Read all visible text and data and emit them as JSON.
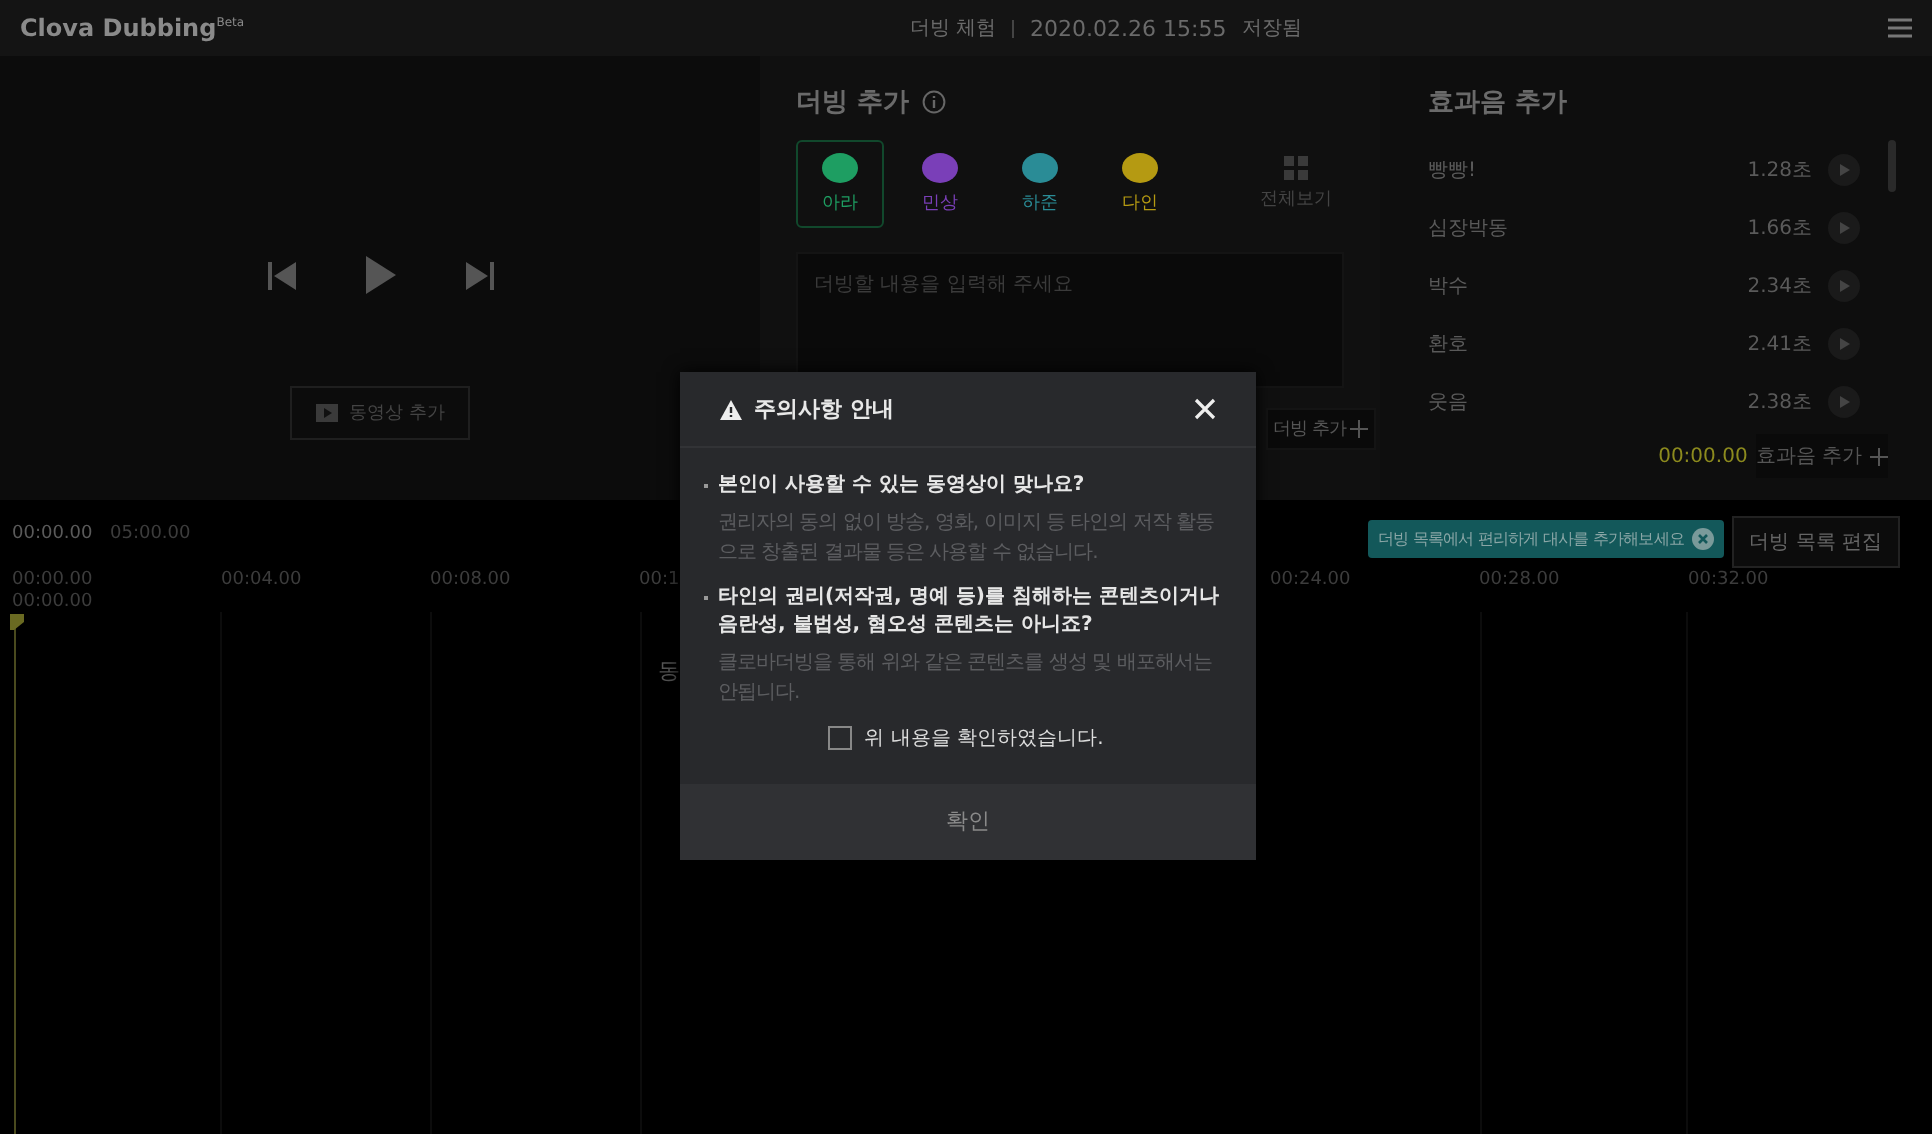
{
  "header": {
    "logo": "Clova Dubbing",
    "logo_badge": "Beta",
    "project": "더빙 체험",
    "saved_time": "2020.02.26 15:55",
    "saved_label": "저장됨"
  },
  "video": {
    "add_button": "동영상 추가"
  },
  "dubbing": {
    "title": "더빙 추가",
    "voices": [
      {
        "name": "아라",
        "color": "#1e9e62",
        "selected": true
      },
      {
        "name": "민상",
        "color": "#7a3fb8",
        "selected": false
      },
      {
        "name": "하준",
        "color": "#2a8c96",
        "selected": false
      },
      {
        "name": "다인",
        "color": "#b59a12",
        "selected": false
      }
    ],
    "all_view": "전체보기",
    "input": {
      "placeholder": "더빙할 내용을 입력해 주세요"
    },
    "add_button": "더빙 추가"
  },
  "effects": {
    "title": "효과음 추가",
    "items": [
      {
        "name": "빵빵!",
        "duration": "1.28초"
      },
      {
        "name": "심장박동",
        "duration": "1.66초"
      },
      {
        "name": "박수",
        "duration": "2.34초"
      },
      {
        "name": "환호",
        "duration": "2.41초"
      },
      {
        "name": "웃음",
        "duration": "2.38초"
      }
    ],
    "time": "00:00.00",
    "add_button": "효과음 추가"
  },
  "timeline": {
    "current": "00:00.00",
    "total": "05:00.00",
    "ticks_left": [
      "00:00.00",
      "00:04.00",
      "00:08.00",
      "00:1"
    ],
    "ticks_right": [
      "00:24.00",
      "00:28.00",
      "00:32.00"
    ],
    "playhead_time": "00:00.00",
    "clip_text": "동",
    "tooltip": "더빙 목록에서 편리하게 대사를 추가해보세요",
    "edit_button": "더빙 목록 편집"
  },
  "modal": {
    "title": "주의사항 안내",
    "items": [
      {
        "question": "본인이 사용할 수 있는 동영상이 맞나요?",
        "note": "권리자의 동의 없이 방송, 영화, 이미지 등 타인의 저작 활동으로 창출된 결과물 등은 사용할 수 없습니다."
      },
      {
        "question": "타인의 권리(저작권, 명예 등)를 침해하는 콘텐츠이거나 음란성, 불법성, 혐오성 콘텐츠는 아니죠?",
        "note": "클로바더빙을 통해 위와 같은 콘텐츠를 생성 및 배포해서는 안됩니다."
      }
    ],
    "confirm": {
      "label": "위 내용을 확인하였습니다.",
      "checked": false
    },
    "ok_button": "확인"
  }
}
